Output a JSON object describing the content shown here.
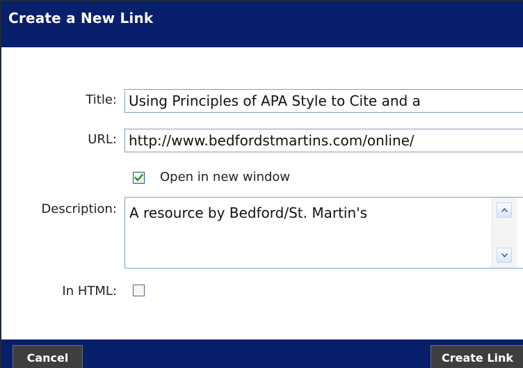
{
  "dialog": {
    "title": "Create a New Link"
  },
  "form": {
    "title_label": "Title:",
    "title_value": "Using Principles of APA Style to Cite and a",
    "url_label": "URL:",
    "url_value": "http://www.bedfordstmartins.com/online/",
    "open_new_window_label": "Open in new window",
    "open_new_window_checked": true,
    "description_label": "Description:",
    "description_value": "A resource by Bedford/St. Martin's",
    "in_html_label": "In HTML:",
    "in_html_checked": false
  },
  "footer": {
    "cancel_label": "Cancel",
    "create_label": "Create Link"
  },
  "colors": {
    "header_bg": "#08206b",
    "button_bg": "#3e3e3e",
    "check_green": "#1e9a1e",
    "input_border": "#7f9db9"
  },
  "icons": {
    "checkmark": "checkmark-icon",
    "scroll_up": "scroll-up-arrow-icon",
    "scroll_down": "scroll-down-arrow-icon"
  }
}
